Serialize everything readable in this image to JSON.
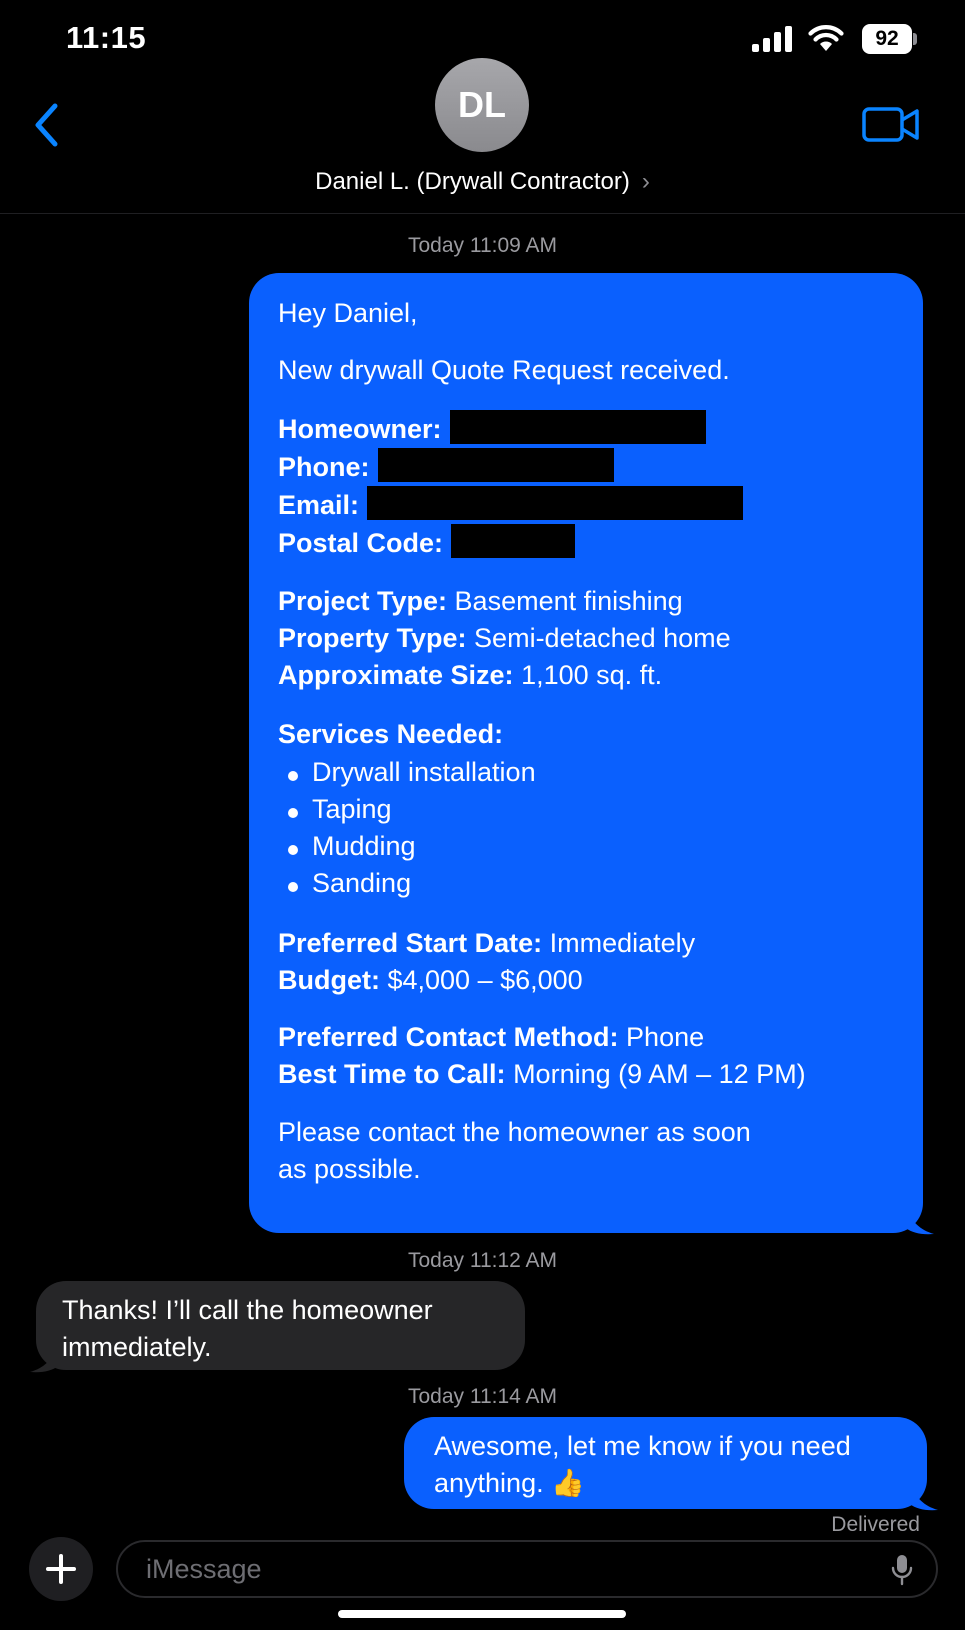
{
  "status_bar": {
    "time": "11:15",
    "battery": "92"
  },
  "header": {
    "avatar_initials": "DL",
    "contact_name": "Daniel L. (Drywall Contractor)",
    "chevron": "›"
  },
  "messages": {
    "ts1": "Today 11:09 AM",
    "quote": {
      "greeting": "Hey Daniel,",
      "intro": "New drywall Quote Request received.",
      "homeowner_label": "Homeowner:",
      "phone_label": "Phone:",
      "email_label": "Email:",
      "postal_label": "Postal Code:",
      "project_type_label": "Project Type:",
      "project_type_value": " Basement finishing",
      "property_type_label": "Property Type:",
      "property_type_value": " Semi-detached home",
      "size_label": "Approximate Size:",
      "size_value": " 1,100 sq. ft.",
      "services_label": "Services Needed:",
      "services": [
        "Drywall installation",
        "Taping",
        "Mudding",
        "Sanding"
      ],
      "start_label": "Preferred Start Date:",
      "start_value": " Immediately",
      "budget_label": "Budget:",
      "budget_value": " $4,000 – $6,000",
      "contact_method_label": "Preferred Contact Method:",
      "contact_method_value": " Phone",
      "best_time_label": "Best Time to Call:",
      "best_time_value": " Morning (9 AM – 12 PM)",
      "closing_line1": "Please contact the homeowner as soon",
      "closing_line2": "as possible."
    },
    "ts2": "Today 11:12 AM",
    "reply_line1": "Thanks!  I’ll call the homeowner",
    "reply_line2": "immediately.",
    "ts3": "Today 11:14 AM",
    "out2_line1": "Awesome, let me know if you need",
    "out2_line2": "anything. 👍",
    "delivered": "Delivered"
  },
  "compose": {
    "placeholder": "iMessage"
  },
  "colors": {
    "outgoing_bubble": "#0a60fe",
    "incoming_bubble": "#262628",
    "accent": "#0a84ff",
    "background": "#000000"
  },
  "icons": [
    "back-chevron-icon",
    "video-camera-icon",
    "plus-icon",
    "microphone-icon",
    "signal-icon",
    "wifi-icon",
    "battery-icon"
  ]
}
